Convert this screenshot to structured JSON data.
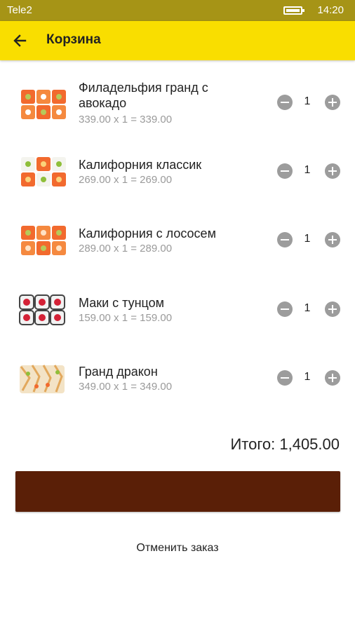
{
  "status_bar": {
    "carrier": "Tele2",
    "time": "14:20"
  },
  "app_bar": {
    "title": "Корзина"
  },
  "cart": {
    "items": [
      {
        "name": "Филадельфия гранд с авокадо",
        "calc": "339.00 x 1 = 339.00",
        "qty": "1"
      },
      {
        "name": "Калифорния классик",
        "calc": "269.00 x 1 = 269.00",
        "qty": "1"
      },
      {
        "name": "Калифорния с лососем",
        "calc": "289.00 x 1 = 289.00",
        "qty": "1"
      },
      {
        "name": "Маки с тунцом",
        "calc": "159.00 x 1 = 159.00",
        "qty": "1"
      },
      {
        "name": "Гранд дракон",
        "calc": "349.00 x 1 = 349.00",
        "qty": "1"
      }
    ],
    "total": "Итого: 1,405.00"
  },
  "actions": {
    "checkout_label": "",
    "cancel_label": "Отменить заказ"
  },
  "colors": {
    "accent": "#f9de00",
    "status_bar": "#a69416",
    "checkout": "#5a1f07"
  },
  "icons": {
    "back": "arrow-left-icon",
    "decrease": "minus-circle-icon",
    "increase": "plus-circle-icon"
  }
}
